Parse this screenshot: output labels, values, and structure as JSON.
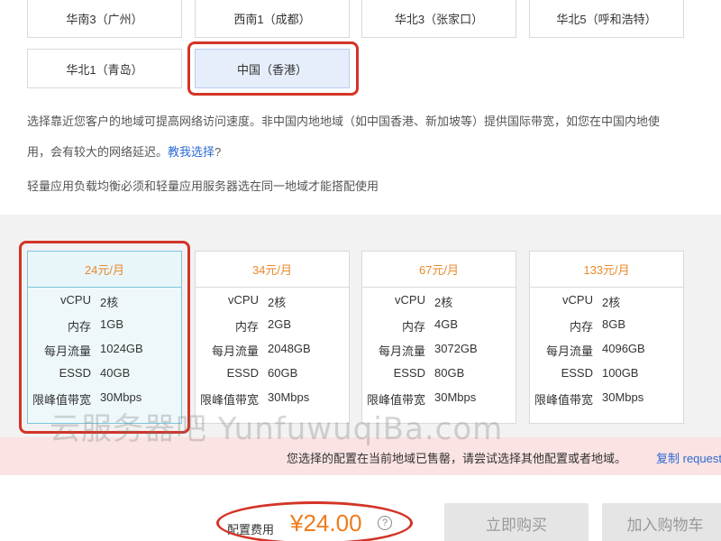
{
  "regions": [
    {
      "label": "华南3（广州）",
      "selected": false
    },
    {
      "label": "西南1（成都）",
      "selected": false
    },
    {
      "label": "华北3（张家口）",
      "selected": false
    },
    {
      "label": "华北5（呼和浩特）",
      "selected": false
    },
    {
      "label": "华北1（青岛）",
      "selected": false
    },
    {
      "label": "中国（香港）",
      "selected": true
    }
  ],
  "description": {
    "line1": "选择靠近您客户的地域可提高网络访问速度。非中国内地地域（如中国香港、新加坡等）提供国际带宽，如您在中国内地使",
    "line2_prefix": "用，会有较大的网络延迟。",
    "line2_link": "教我选择",
    "line2_suffix": "?",
    "line3": "轻量应用负载均衡必须和轻量应用服务器选在同一地域才能搭配使用"
  },
  "plans": [
    {
      "price": "24元/月",
      "selected": true,
      "specs": [
        {
          "k": "vCPU",
          "v": "2核"
        },
        {
          "k": "内存",
          "v": "1GB"
        },
        {
          "k": "每月流量",
          "v": "1024GB"
        },
        {
          "k": "ESSD",
          "v": "40GB"
        },
        {
          "k": "限峰值带宽",
          "v": "30Mbps"
        }
      ]
    },
    {
      "price": "34元/月",
      "selected": false,
      "specs": [
        {
          "k": "vCPU",
          "v": "2核"
        },
        {
          "k": "内存",
          "v": "2GB"
        },
        {
          "k": "每月流量",
          "v": "2048GB"
        },
        {
          "k": "ESSD",
          "v": "60GB"
        },
        {
          "k": "限峰值带宽",
          "v": "30Mbps"
        }
      ]
    },
    {
      "price": "67元/月",
      "selected": false,
      "specs": [
        {
          "k": "vCPU",
          "v": "2核"
        },
        {
          "k": "内存",
          "v": "4GB"
        },
        {
          "k": "每月流量",
          "v": "3072GB"
        },
        {
          "k": "ESSD",
          "v": "80GB"
        },
        {
          "k": "限峰值带宽",
          "v": "30Mbps"
        }
      ]
    },
    {
      "price": "133元/月",
      "selected": false,
      "specs": [
        {
          "k": "vCPU",
          "v": "2核"
        },
        {
          "k": "内存",
          "v": "8GB"
        },
        {
          "k": "每月流量",
          "v": "4096GB"
        },
        {
          "k": "ESSD",
          "v": "100GB"
        },
        {
          "k": "限峰值带宽",
          "v": "30Mbps"
        }
      ]
    }
  ],
  "watermark": "云服务器吧 YunfuwuqiBa.com",
  "banner": {
    "text": "您选择的配置在当前地域已售罄，请尝试选择其他配置或者地域。",
    "link": "复制 request"
  },
  "footer": {
    "fee_label": "配置费用",
    "fee_value": "¥24.00",
    "help_icon": "?",
    "buy_label": "立即购买",
    "cart_label": "加入购物车"
  },
  "colors": {
    "accent_red": "#d33427",
    "price_orange": "#f07c1c",
    "link_blue": "#2d6bd2"
  }
}
